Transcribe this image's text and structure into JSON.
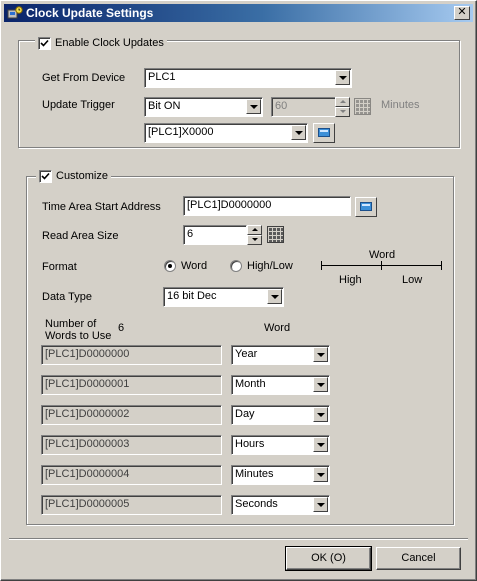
{
  "window": {
    "title": "Clock Update Settings",
    "close_glyph": "✕"
  },
  "enable_group": {
    "checkbox_label": "Enable Clock Updates",
    "checked": true,
    "get_from_device": {
      "label": "Get From Device",
      "value": "PLC1"
    },
    "update_trigger": {
      "label": "Update Trigger",
      "value": "Bit ON",
      "interval_value": "60",
      "interval_unit": "Minutes",
      "address_value": "[PLC1]X0000"
    }
  },
  "customize_group": {
    "checkbox_label": "Customize",
    "checked": true,
    "time_area": {
      "label": "Time Area Start Address",
      "value": "[PLC1]D0000000"
    },
    "read_area": {
      "label": "Read Area Size",
      "value": "6"
    },
    "format": {
      "label": "Format",
      "options": [
        "Word",
        "High/Low"
      ],
      "selected": "Word",
      "diagram": {
        "top": "Word",
        "left": "High",
        "right": "Low"
      }
    },
    "data_type": {
      "label": "Data Type",
      "value": "16 bit Dec"
    },
    "words_to_use": {
      "label_line1": "Number of",
      "label_line2": "Words to Use",
      "value": "6"
    },
    "word_column_header": "Word",
    "rows": [
      {
        "address": "[PLC1]D0000000",
        "word": "Year"
      },
      {
        "address": "[PLC1]D0000001",
        "word": "Month"
      },
      {
        "address": "[PLC1]D0000002",
        "word": "Day"
      },
      {
        "address": "[PLC1]D0000003",
        "word": "Hours"
      },
      {
        "address": "[PLC1]D0000004",
        "word": "Minutes"
      },
      {
        "address": "[PLC1]D0000005",
        "word": "Seconds"
      }
    ]
  },
  "buttons": {
    "ok": "OK (O)",
    "cancel": "Cancel"
  },
  "icons": {
    "app": "app-icon",
    "checkbox_mark": "check-icon",
    "address_picker": "address-input-icon",
    "keypad": "keypad-icon"
  },
  "colors": {
    "titlebar_start": "#0a246a",
    "titlebar_end": "#a6caf0",
    "face": "#d4d0c8"
  }
}
